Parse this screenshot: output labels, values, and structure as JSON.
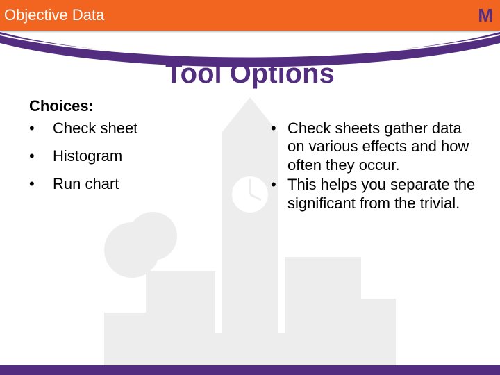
{
  "header": {
    "title": "Objective Data",
    "badge": "M"
  },
  "slide": {
    "title": "Tool Options",
    "choices_label": "Choices:",
    "left_items": [
      "Check sheet",
      "Histogram",
      "Run chart"
    ],
    "right_items": [
      "Check sheets gather data on various effects and how often they occur.",
      "This helps you separate the significant from the trivial."
    ]
  },
  "colors": {
    "orange": "#f26521",
    "purple": "#522d80"
  }
}
